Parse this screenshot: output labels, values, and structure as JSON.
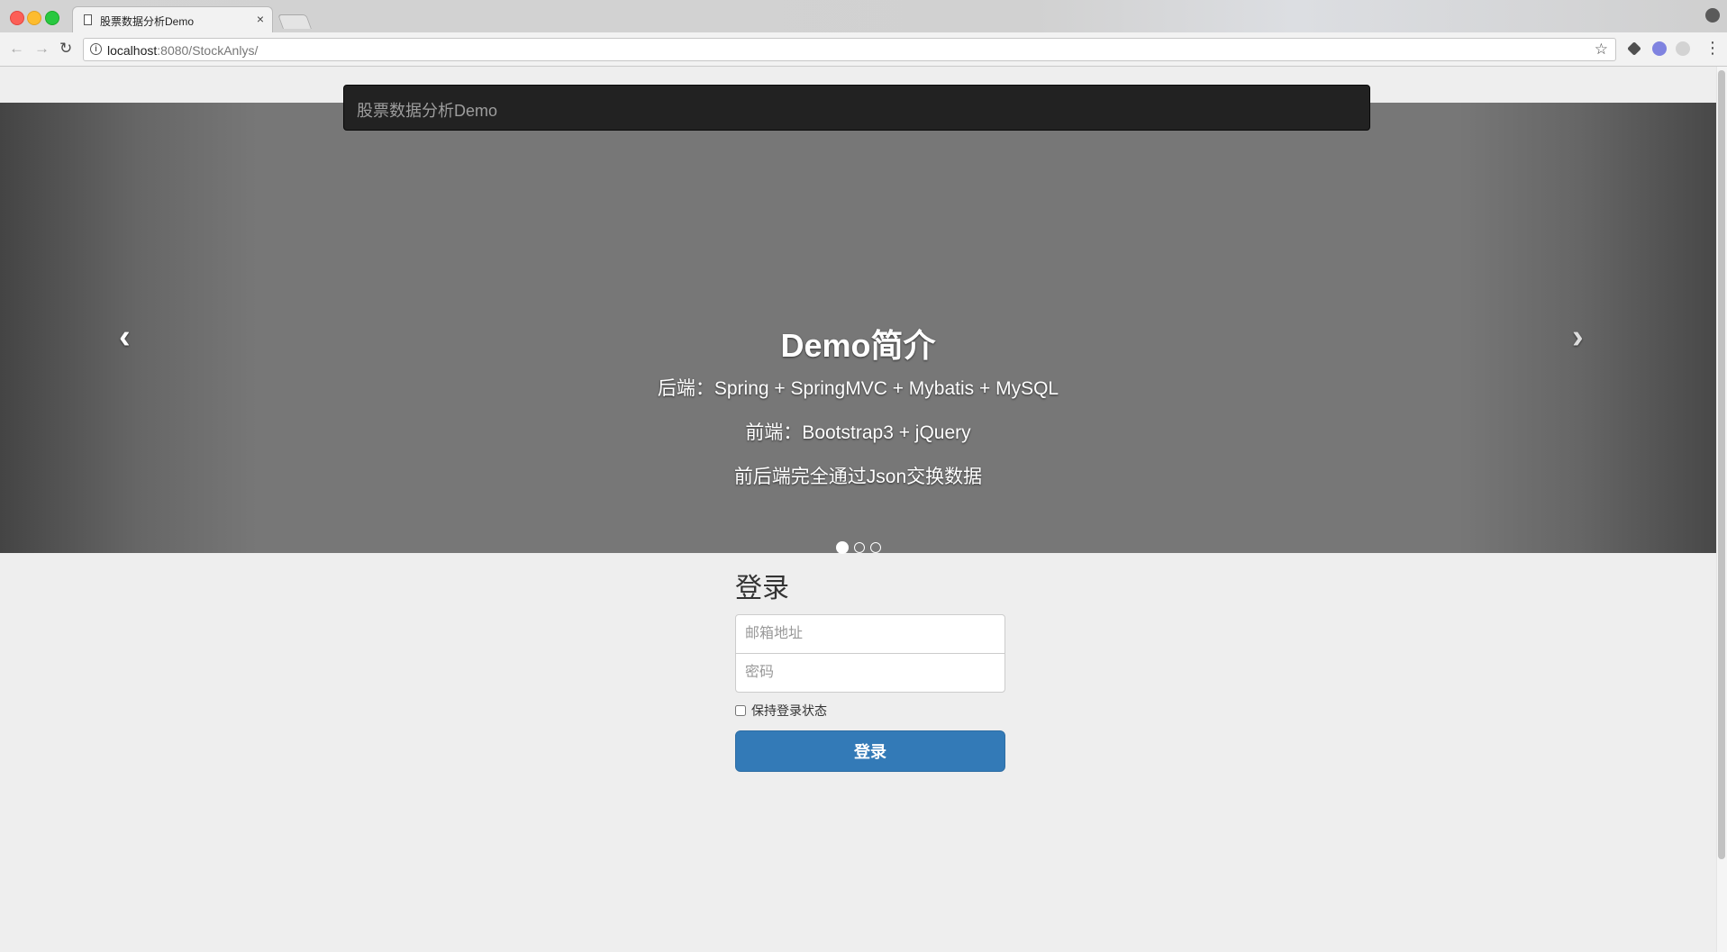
{
  "browser": {
    "tab_title": "股票数据分析Demo",
    "tab_close": "×",
    "url_host": "localhost",
    "url_path": ":8080/StockAnlys/"
  },
  "navbar": {
    "brand": "股票数据分析Demo"
  },
  "carousel": {
    "heading": "Demo简介",
    "lines": [
      "后端：Spring + SpringMVC + Mybatis + MySQL",
      "前端：Bootstrap3 + jQuery",
      "前后端完全通过Json交换数据"
    ],
    "prev_label": "‹",
    "next_label": "›",
    "slide_count": 3,
    "active_slide": 1
  },
  "signin": {
    "heading": "登录",
    "email_placeholder": "邮箱地址",
    "password_placeholder": "密码",
    "remember_label": "保持登录状态",
    "remember_checked": false,
    "submit_label": "登录"
  },
  "colors": {
    "navbar_bg": "#222222",
    "brand_text": "#9d9d9d",
    "primary_button": "#337ab7",
    "carousel_bg": "#777777",
    "page_bg": "#eeeeee"
  },
  "icons": {
    "page": "page-icon",
    "info": "info-icon",
    "bookmark": "star-icon",
    "prev": "chevron-left-icon",
    "next": "chevron-right-icon"
  }
}
